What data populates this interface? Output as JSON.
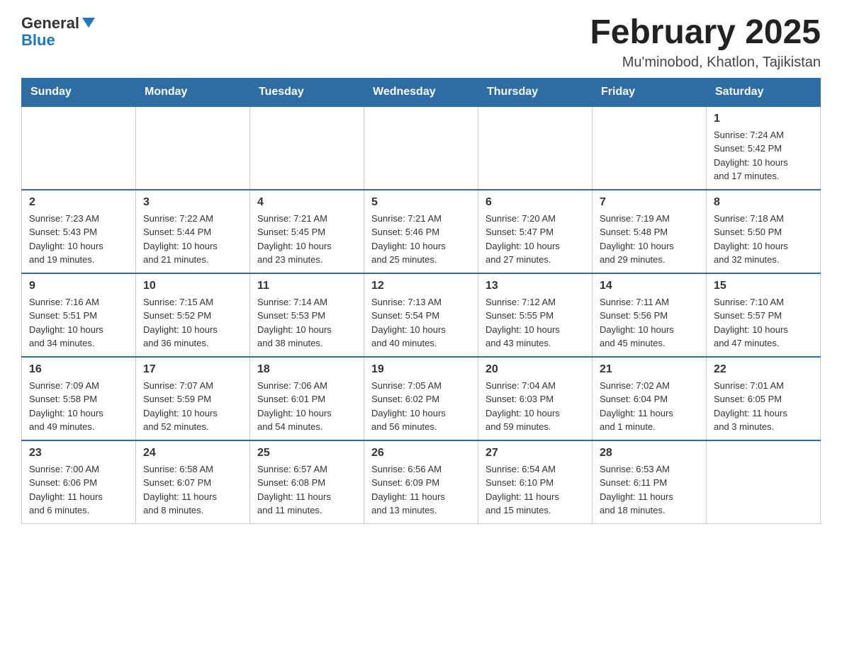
{
  "header": {
    "logo": {
      "general": "General",
      "blue": "Blue"
    },
    "title": "February 2025",
    "location": "Mu'minobod, Khatlon, Tajikistan"
  },
  "weekdays": [
    "Sunday",
    "Monday",
    "Tuesday",
    "Wednesday",
    "Thursday",
    "Friday",
    "Saturday"
  ],
  "weeks": [
    [
      {
        "day": "",
        "info": ""
      },
      {
        "day": "",
        "info": ""
      },
      {
        "day": "",
        "info": ""
      },
      {
        "day": "",
        "info": ""
      },
      {
        "day": "",
        "info": ""
      },
      {
        "day": "",
        "info": ""
      },
      {
        "day": "1",
        "info": "Sunrise: 7:24 AM\nSunset: 5:42 PM\nDaylight: 10 hours\nand 17 minutes."
      }
    ],
    [
      {
        "day": "2",
        "info": "Sunrise: 7:23 AM\nSunset: 5:43 PM\nDaylight: 10 hours\nand 19 minutes."
      },
      {
        "day": "3",
        "info": "Sunrise: 7:22 AM\nSunset: 5:44 PM\nDaylight: 10 hours\nand 21 minutes."
      },
      {
        "day": "4",
        "info": "Sunrise: 7:21 AM\nSunset: 5:45 PM\nDaylight: 10 hours\nand 23 minutes."
      },
      {
        "day": "5",
        "info": "Sunrise: 7:21 AM\nSunset: 5:46 PM\nDaylight: 10 hours\nand 25 minutes."
      },
      {
        "day": "6",
        "info": "Sunrise: 7:20 AM\nSunset: 5:47 PM\nDaylight: 10 hours\nand 27 minutes."
      },
      {
        "day": "7",
        "info": "Sunrise: 7:19 AM\nSunset: 5:48 PM\nDaylight: 10 hours\nand 29 minutes."
      },
      {
        "day": "8",
        "info": "Sunrise: 7:18 AM\nSunset: 5:50 PM\nDaylight: 10 hours\nand 32 minutes."
      }
    ],
    [
      {
        "day": "9",
        "info": "Sunrise: 7:16 AM\nSunset: 5:51 PM\nDaylight: 10 hours\nand 34 minutes."
      },
      {
        "day": "10",
        "info": "Sunrise: 7:15 AM\nSunset: 5:52 PM\nDaylight: 10 hours\nand 36 minutes."
      },
      {
        "day": "11",
        "info": "Sunrise: 7:14 AM\nSunset: 5:53 PM\nDaylight: 10 hours\nand 38 minutes."
      },
      {
        "day": "12",
        "info": "Sunrise: 7:13 AM\nSunset: 5:54 PM\nDaylight: 10 hours\nand 40 minutes."
      },
      {
        "day": "13",
        "info": "Sunrise: 7:12 AM\nSunset: 5:55 PM\nDaylight: 10 hours\nand 43 minutes."
      },
      {
        "day": "14",
        "info": "Sunrise: 7:11 AM\nSunset: 5:56 PM\nDaylight: 10 hours\nand 45 minutes."
      },
      {
        "day": "15",
        "info": "Sunrise: 7:10 AM\nSunset: 5:57 PM\nDaylight: 10 hours\nand 47 minutes."
      }
    ],
    [
      {
        "day": "16",
        "info": "Sunrise: 7:09 AM\nSunset: 5:58 PM\nDaylight: 10 hours\nand 49 minutes."
      },
      {
        "day": "17",
        "info": "Sunrise: 7:07 AM\nSunset: 5:59 PM\nDaylight: 10 hours\nand 52 minutes."
      },
      {
        "day": "18",
        "info": "Sunrise: 7:06 AM\nSunset: 6:01 PM\nDaylight: 10 hours\nand 54 minutes."
      },
      {
        "day": "19",
        "info": "Sunrise: 7:05 AM\nSunset: 6:02 PM\nDaylight: 10 hours\nand 56 minutes."
      },
      {
        "day": "20",
        "info": "Sunrise: 7:04 AM\nSunset: 6:03 PM\nDaylight: 10 hours\nand 59 minutes."
      },
      {
        "day": "21",
        "info": "Sunrise: 7:02 AM\nSunset: 6:04 PM\nDaylight: 11 hours\nand 1 minute."
      },
      {
        "day": "22",
        "info": "Sunrise: 7:01 AM\nSunset: 6:05 PM\nDaylight: 11 hours\nand 3 minutes."
      }
    ],
    [
      {
        "day": "23",
        "info": "Sunrise: 7:00 AM\nSunset: 6:06 PM\nDaylight: 11 hours\nand 6 minutes."
      },
      {
        "day": "24",
        "info": "Sunrise: 6:58 AM\nSunset: 6:07 PM\nDaylight: 11 hours\nand 8 minutes."
      },
      {
        "day": "25",
        "info": "Sunrise: 6:57 AM\nSunset: 6:08 PM\nDaylight: 11 hours\nand 11 minutes."
      },
      {
        "day": "26",
        "info": "Sunrise: 6:56 AM\nSunset: 6:09 PM\nDaylight: 11 hours\nand 13 minutes."
      },
      {
        "day": "27",
        "info": "Sunrise: 6:54 AM\nSunset: 6:10 PM\nDaylight: 11 hours\nand 15 minutes."
      },
      {
        "day": "28",
        "info": "Sunrise: 6:53 AM\nSunset: 6:11 PM\nDaylight: 11 hours\nand 18 minutes."
      },
      {
        "day": "",
        "info": ""
      }
    ]
  ]
}
